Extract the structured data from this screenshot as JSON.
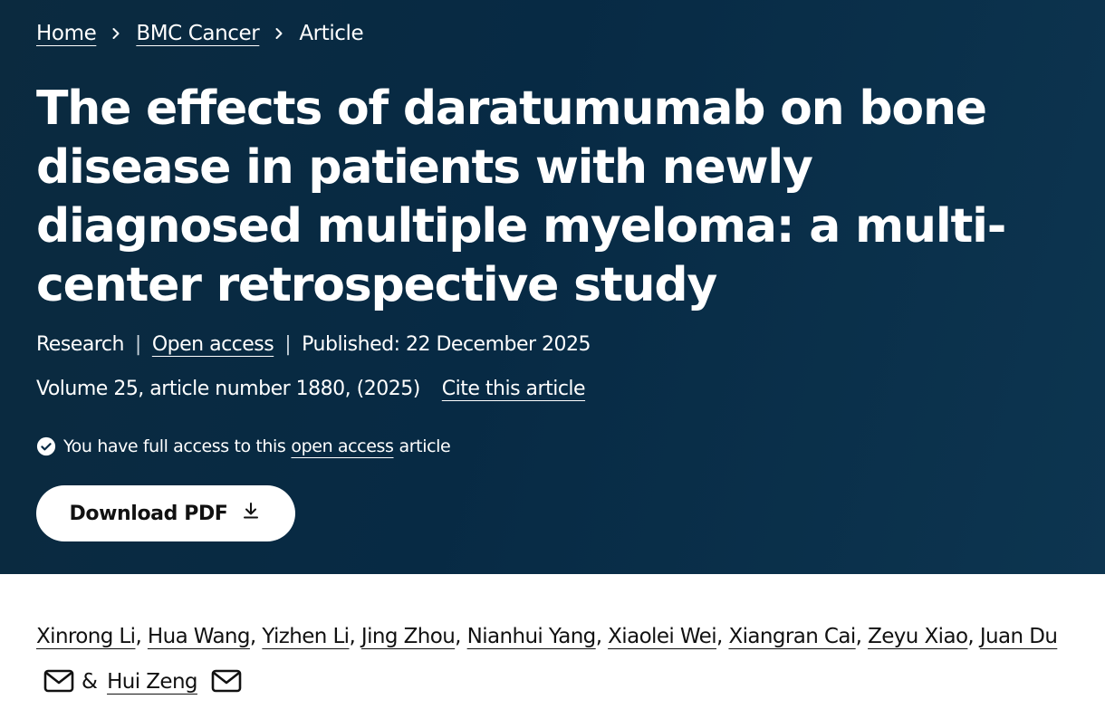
{
  "breadcrumb": {
    "home": "Home",
    "journal": "BMC Cancer",
    "current": "Article"
  },
  "article": {
    "title": "The effects of daratumumab on bone disease in patients with newly diagnosed multiple myeloma: a multi-center retrospective study",
    "type": "Research",
    "access": "Open access",
    "published": "Published: 22 December 2025",
    "volume": "Volume 25, article number 1880, (2025)",
    "cite": "Cite this article"
  },
  "access_note": {
    "prefix": "You have full access to this",
    "link": "open access",
    "suffix": "article"
  },
  "download": {
    "label": "Download PDF"
  },
  "authors": {
    "list": [
      "Xinrong Li",
      "Hua Wang",
      "Yizhen Li",
      "Jing Zhou",
      "Nianhui Yang",
      "Xiaolei Wei",
      "Xiangran Cai",
      "Zeyu Xiao",
      "Juan Du"
    ],
    "and": "&",
    "last": "Hui Zeng"
  },
  "icons": {
    "separator": "chevron-right-icon",
    "check": "check-circle-icon",
    "download": "download-icon",
    "mail": "mail-icon"
  },
  "colors": {
    "hero_bg": "#072a44",
    "text_light": "#ffffff",
    "text_dark": "#111111"
  }
}
